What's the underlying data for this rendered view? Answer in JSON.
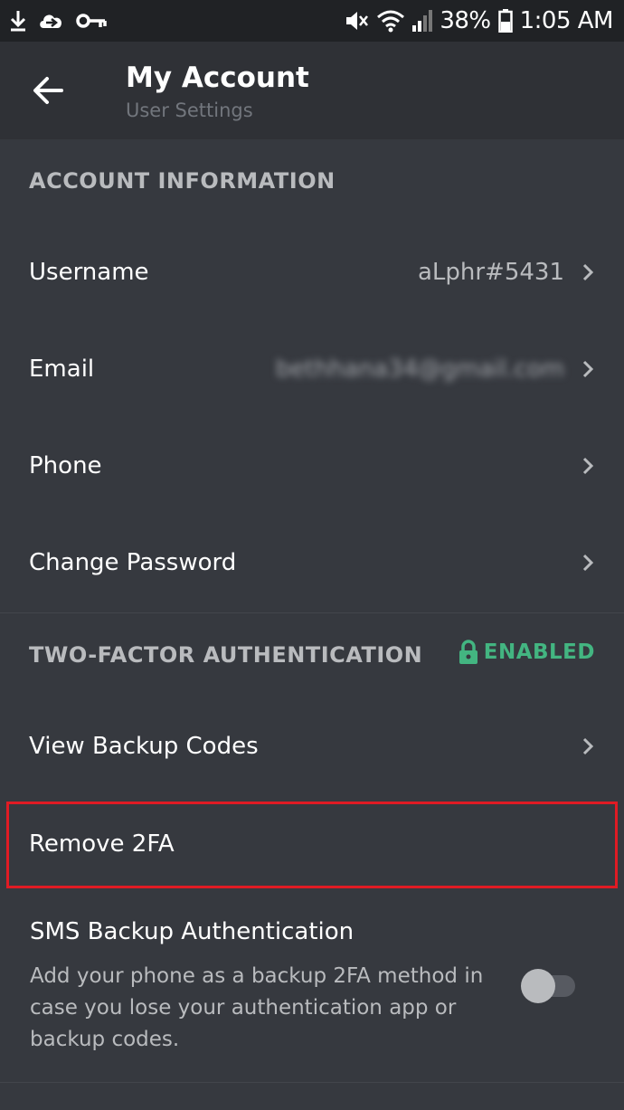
{
  "status_bar": {
    "battery": "38%",
    "time": "1:05 AM",
    "icons": [
      "download-icon",
      "cloud-sync-icon",
      "key-icon",
      "mute-icon",
      "wifi-icon",
      "signal-icon",
      "battery-icon"
    ]
  },
  "header": {
    "title": "My Account",
    "subtitle": "User Settings",
    "back_icon": "back-arrow-icon"
  },
  "account_info": {
    "heading": "ACCOUNT INFORMATION",
    "rows": [
      {
        "label": "Username",
        "value": "aLphr#5431"
      },
      {
        "label": "Email",
        "value": "bethhana34@gmail.com"
      },
      {
        "label": "Phone",
        "value": ""
      },
      {
        "label": "Change Password",
        "value": ""
      }
    ]
  },
  "two_factor": {
    "heading": "TWO-FACTOR AUTHENTICATION",
    "status": "ENABLED",
    "status_color": "#43b581",
    "rows": [
      {
        "label": "View Backup Codes"
      },
      {
        "label": "Remove 2FA"
      }
    ],
    "highlight_color": "#e01b24"
  },
  "sms_backup": {
    "title": "SMS Backup Authentication",
    "description": "Add your phone as a backup 2FA method in case you lose your authentication app or backup codes.",
    "enabled": false
  },
  "colors": {
    "background": "#36393f",
    "header": "#2f3136",
    "status_bar": "#202225"
  }
}
